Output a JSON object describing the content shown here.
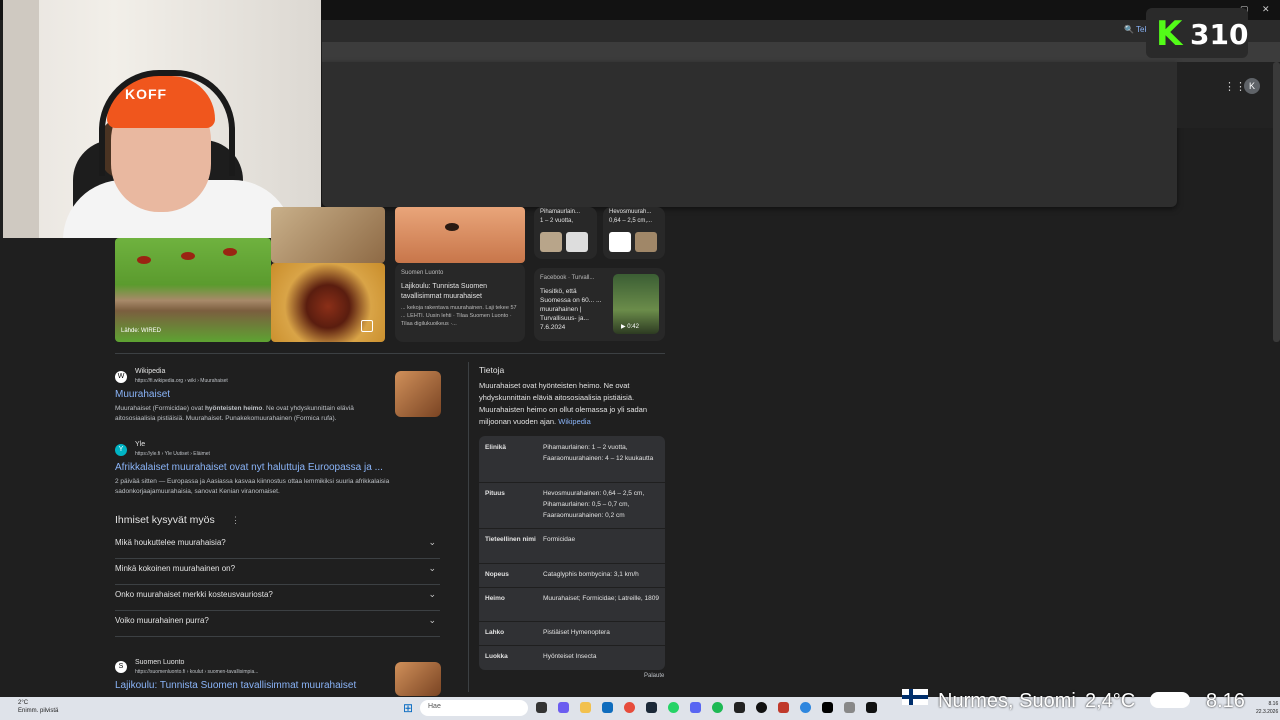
{
  "browser": {
    "lens_label": "Tekst",
    "window_controls": [
      "–",
      "▢",
      "✕"
    ]
  },
  "overlay": {
    "score": "310",
    "score_logo": "K"
  },
  "header": {
    "apps_icon": "apps-grid-icon",
    "account_initial": "K"
  },
  "images": {
    "source_caption": "Lähde: WIRED",
    "cards": [
      {
        "site": "Suomen Luonto",
        "title": "Lajikoulu: Tunnista Suomen tavallisimmat muurahaiset",
        "snippet": "... kekoja rakentava muurahainen. Laji tekee 57 ... LEHTI. Uusin lehti · Tilaa Suomen Luonto · Tilaa digilukuoikeus ·..."
      },
      {
        "site": "Facebook · Turvall...",
        "title": "Tiesitkö, että Suomessa on 60... ... muurahainen | Turvallisuus- ja... 7.6.2024",
        "duration": "0:42"
      }
    ],
    "mini": [
      {
        "title": "Pihamaurlain...",
        "sub": "1 – 2 vuotta,"
      },
      {
        "title": "Hevosmuurah...",
        "sub": "0,64 – 2,5 cm,..."
      }
    ]
  },
  "results": [
    {
      "site": "Wikipedia",
      "url": "https://fi.wikipedia.org › wiki › Muurahaiset",
      "title": "Muurahaiset",
      "snippet_pre": "Muurahaiset (Formicidae) ovat ",
      "snippet_bold": "hyönteisten heimo",
      "snippet_post": ". Ne ovat yhdyskunnittain eläviä aitososiaalisia pistiäisiä. Muurahaiset. Punakekomuurahainen (Formica rufa).",
      "fav": "W"
    },
    {
      "site": "Yle",
      "url": "https://yle.fi › Yle Uutiset › Eläimet",
      "title": "Afrikkalaiset muurahaiset ovat nyt haluttuja Euroopassa ja ...",
      "snippet": "2 päivää sitten — Europassa ja Aasiassa kasvaa kiinnostus ottaa lemmikiksi suuria afrikkalaisia sadonkorjaajamuurahaisia, sanovat Kenian viranomaiset.",
      "fav": "Y"
    },
    {
      "site": "Suomen Luonto",
      "url": "https://suomenluonto.fi › koulut › suomen-tavallisimpia...",
      "title": "Lajikoulu: Tunnista Suomen tavallisimmat muurahaiset",
      "fav": "S"
    }
  ],
  "paa": {
    "title": "Ihmiset kysyvät myös",
    "questions": [
      "Mikä houkuttelee muurahaisia?",
      "Minkä kokoinen muurahainen on?",
      "Onko muurahaiset merkki kosteusvauriosta?",
      "Voiko muurahainen purra?"
    ]
  },
  "kp": {
    "title": "Tietoja",
    "description": "Muurahaiset ovat hyönteisten heimo. Ne ovat yhdyskunnittain eläviä aitososiaalisia pistiäisiä. Muurahaisten heimo on ollut olemassa jo yli sadan miljoonan vuoden ajan.",
    "desc_link": "Wikipedia",
    "rows": [
      {
        "k": "Elinikä",
        "v": "Pihamaurlainen: 1 – 2 vuotta, Faaraomuurahainen: 4 – 12 kuukautta"
      },
      {
        "k": "Pituus",
        "v": "Hevosmuurahainen: 0,64 – 2,5 cm, Pihamaurlainen: 0,5 – 0,7 cm, Faaraomuurahainen: 0,2 cm"
      },
      {
        "k": "Tieteellinen nimi",
        "v": "Formicidae"
      },
      {
        "k": "Nopeus",
        "v": "Cataglyphis bombycina: 3,1 km/h"
      },
      {
        "k": "Heimo",
        "v": "Muurahaiset; Formicidae; Latreille, 1809"
      },
      {
        "k": "Lahko",
        "v": "Pistiäiset Hymenoptera"
      },
      {
        "k": "Luokka",
        "v": "Hyönteiset Insecta"
      }
    ],
    "feedback": "Palaute"
  },
  "taskbar": {
    "weather_temp": "2°C",
    "weather_desc": "Enimm. pilvistä",
    "search_placeholder": "Hae",
    "location": "Nurmes, Suomi",
    "temp_big": "2,4°C",
    "clock_big": "8.16",
    "clock_time": "8.16",
    "clock_date": "22.3.2026"
  }
}
